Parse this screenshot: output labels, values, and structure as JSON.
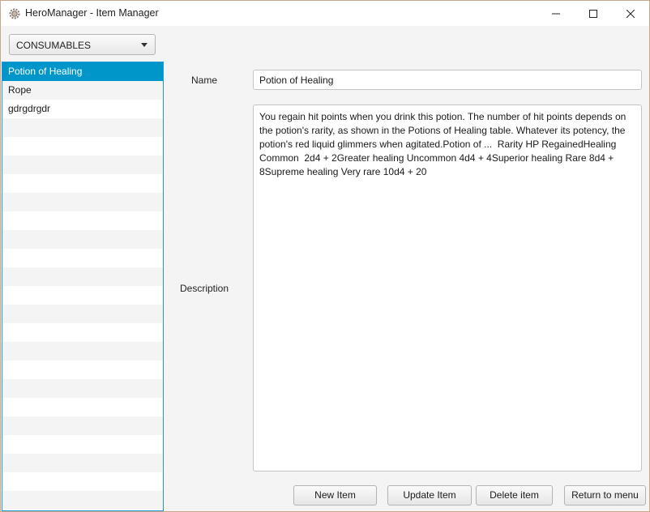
{
  "window": {
    "title": "HeroManager - Item Manager",
    "icon": "gear-app-icon"
  },
  "category": {
    "selected": "CONSUMABLES"
  },
  "items": [
    {
      "label": "Potion of Healing",
      "selected": true
    },
    {
      "label": "Rope",
      "selected": false
    },
    {
      "label": "gdrgdrgdr",
      "selected": false
    }
  ],
  "form": {
    "name_label": "Name",
    "name_value": "Potion of Healing",
    "description_label": "Description",
    "description_value": "You regain hit points when you drink this potion. The number of hit points depends on the potion's rarity, as shown in the Potions of Healing table. Whatever its potency, the potion's red liquid glimmers when agitated.Potion of ...  Rarity HP RegainedHealing Common  2d4 + 2Greater healing Uncommon 4d4 + 4Superior healing Rare 8d4 + 8Supreme healing Very rare 10d4 + 20"
  },
  "buttons": {
    "new_item": "New Item",
    "update_item": "Update Item",
    "delete_item": "Delete item",
    "return_to_menu": "Return to menu"
  },
  "colors": {
    "selection": "#0096c9",
    "list_border": "#1e9bd6",
    "window_border": "#c9a98a"
  }
}
